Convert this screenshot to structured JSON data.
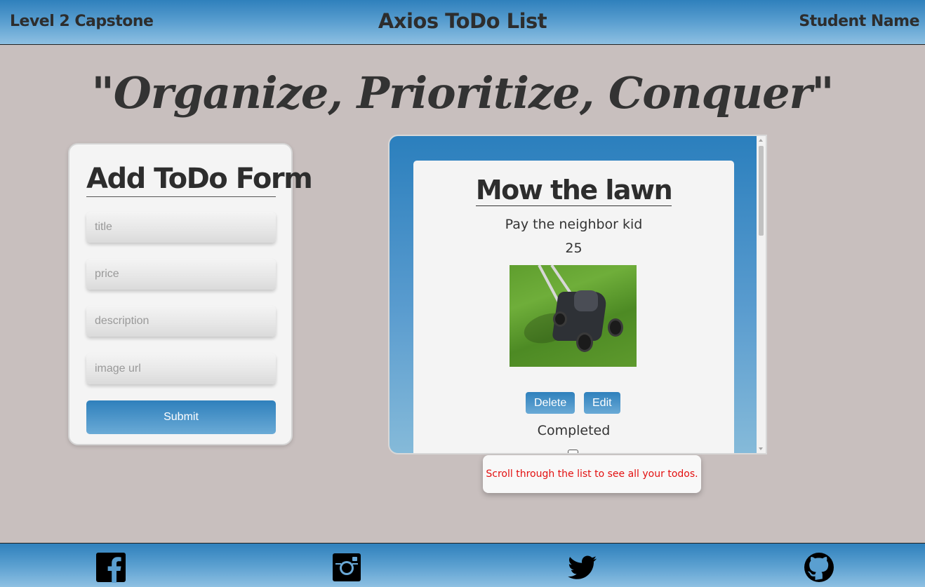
{
  "header": {
    "left_text": "Level 2 Capstone",
    "title": "Axios ToDo List",
    "right_text": "Student Name"
  },
  "slogan": "\"Organize, Prioritize, Conquer\"",
  "form": {
    "title": "Add ToDo Form",
    "fields": {
      "title_placeholder": "title",
      "price_placeholder": "price",
      "description_placeholder": "description",
      "image_url_placeholder": "image url"
    },
    "submit_label": "Submit"
  },
  "todos": [
    {
      "title": "Mow the lawn",
      "description": "Pay the neighbor kid",
      "price": "25",
      "image": "lawn-mower-photo",
      "delete_label": "Delete",
      "edit_label": "Edit",
      "completed_label": "Completed",
      "completed": false
    }
  ],
  "tooltip": "Scroll through the list to see all your todos.",
  "footer": {
    "icons": [
      "facebook-icon",
      "instagram-icon",
      "twitter-icon",
      "github-icon"
    ]
  },
  "colors": {
    "accent": "#2f80bc",
    "background": "#c8bfbe",
    "tooltip_text": "#e31010"
  }
}
